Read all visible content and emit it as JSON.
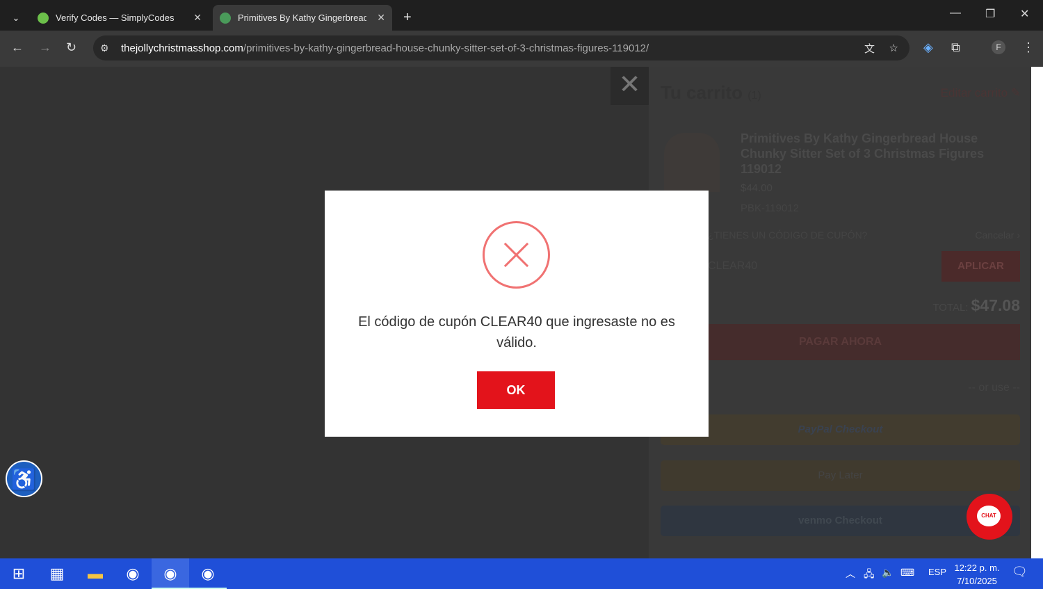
{
  "browser": {
    "tabs": [
      {
        "title": "Verify Codes — SimplyCodes",
        "active": false
      },
      {
        "title": "Primitives By Kathy Gingerbread",
        "active": true
      }
    ],
    "url_host": "thejollychristmasshop.com",
    "url_path": "/primitives-by-kathy-gingerbread-house-chunky-sitter-set-of-3-christmas-figures-119012/",
    "profile_initial": "F"
  },
  "cart": {
    "title": "Tu carrito",
    "count": "(1)",
    "edit_label": "Editar carrito",
    "product_name": "Primitives By Kathy Gingerbread House Chunky Sitter Set of 3 Christmas Figures 119012",
    "price": "$44.00",
    "sku": "PBK-119012",
    "coupon_question": "¿TIENES UN CÓDIGO DE CUPÓN?",
    "cancel_label": "Cancelar ›",
    "coupon_value": "CLEAR40",
    "apply_label": "APLICAR",
    "total_label": "TOTAL:",
    "total_value": "$47.08",
    "pay_now_label": "PAGAR AHORA",
    "or_use": "-- or use --",
    "paypal_label": "PayPal Checkout",
    "paylater_label": "Pay Later",
    "venmo_label": "venmo Checkout"
  },
  "modal": {
    "message": "El código de cupón CLEAR40 que ingresaste no es válido.",
    "ok_label": "OK",
    "icon": "error-x-circle",
    "accent": "#e3131b"
  },
  "chat": {
    "label": "CHAT"
  },
  "taskbar": {
    "language": "ESP",
    "time": "12:22 p. m.",
    "date": "7/10/2025"
  }
}
